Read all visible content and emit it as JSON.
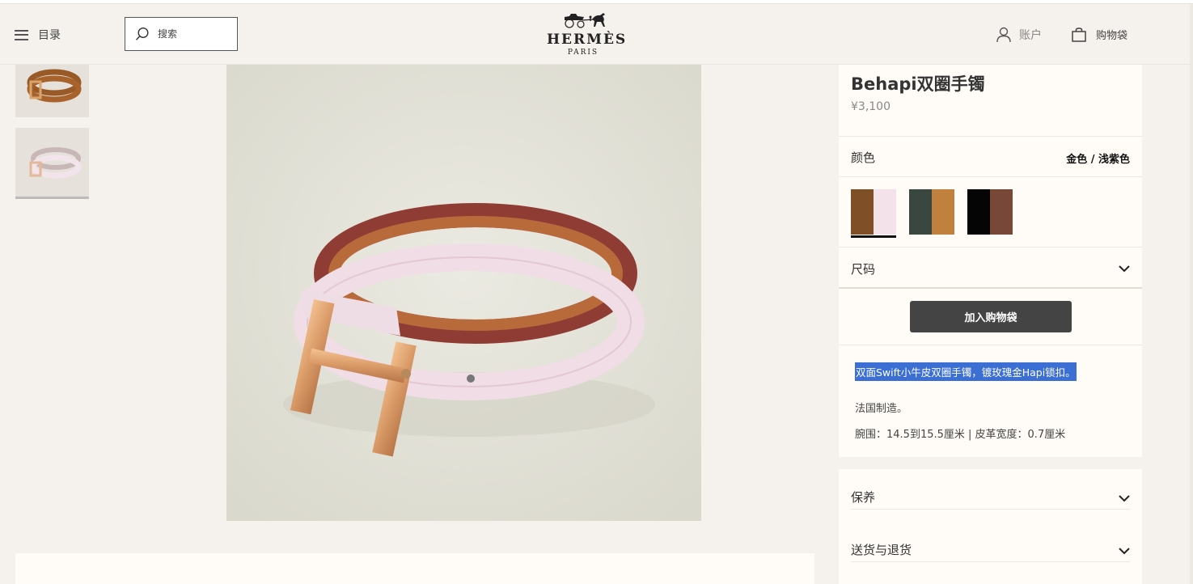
{
  "header": {
    "menu_label": "目录",
    "search_placeholder": "搜索",
    "logo_name": "HERMÈS",
    "logo_sub": "PARIS",
    "account_label": "账户",
    "bag_label": "购物袋"
  },
  "product": {
    "title": "Behapi双圈手镯",
    "price": "¥3,100",
    "color_label": "颜色",
    "color_value": "金色 / 浅紫色",
    "swatches": [
      {
        "name": "gold-light-purple",
        "colors": [
          "#7f4f28",
          "#f3e2ea"
        ],
        "selected": true
      },
      {
        "name": "green-tan",
        "colors": [
          "#3a4741",
          "#c0813f"
        ],
        "selected": false
      },
      {
        "name": "black-brown",
        "colors": [
          "#050505",
          "#774838"
        ],
        "selected": false
      }
    ],
    "size_label": "尺码",
    "add_to_bag": "加入购物袋",
    "description_highlight": "双面Swift小牛皮双圈手镯，镀玫瑰金Hapi锁扣。",
    "made_in": "法国制造。",
    "dimensions": "腕围：14.5到15.5厘米 | 皮革宽度：0.7厘米"
  },
  "accordion": {
    "care_label": "保养",
    "shipping_label": "送货与退货"
  },
  "colors": {
    "background": "#f5f1ec",
    "panel": "#fffcf7",
    "button": "#444444",
    "highlight": "#3b6fd4"
  }
}
